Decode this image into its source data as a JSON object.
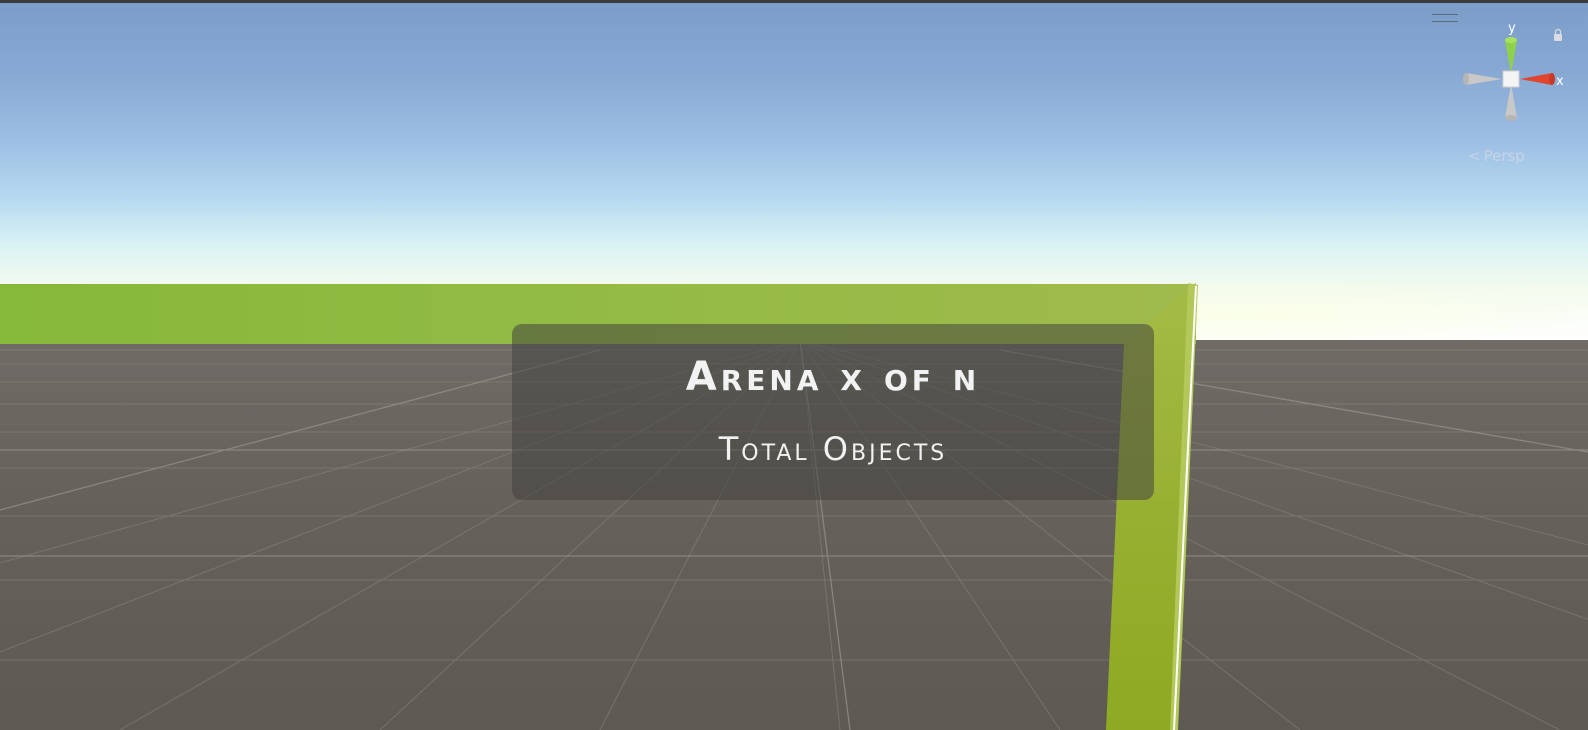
{
  "scene": {
    "panel_title": "Arena x of n",
    "panel_subtitle": "Total Objects"
  },
  "gizmo": {
    "axis_y_label": "y",
    "axis_x_label": "x",
    "projection_label": "Persp",
    "projection_icon": "chevron-left-icon"
  },
  "colors": {
    "sky_top": "#7b9dc8",
    "horizon": "#ffffff",
    "ground": "#66615b",
    "wall_green": "#93bb44",
    "axis_y": "#8fd24a",
    "axis_x": "#e0452f",
    "axis_neutral": "#c8c8c8"
  }
}
